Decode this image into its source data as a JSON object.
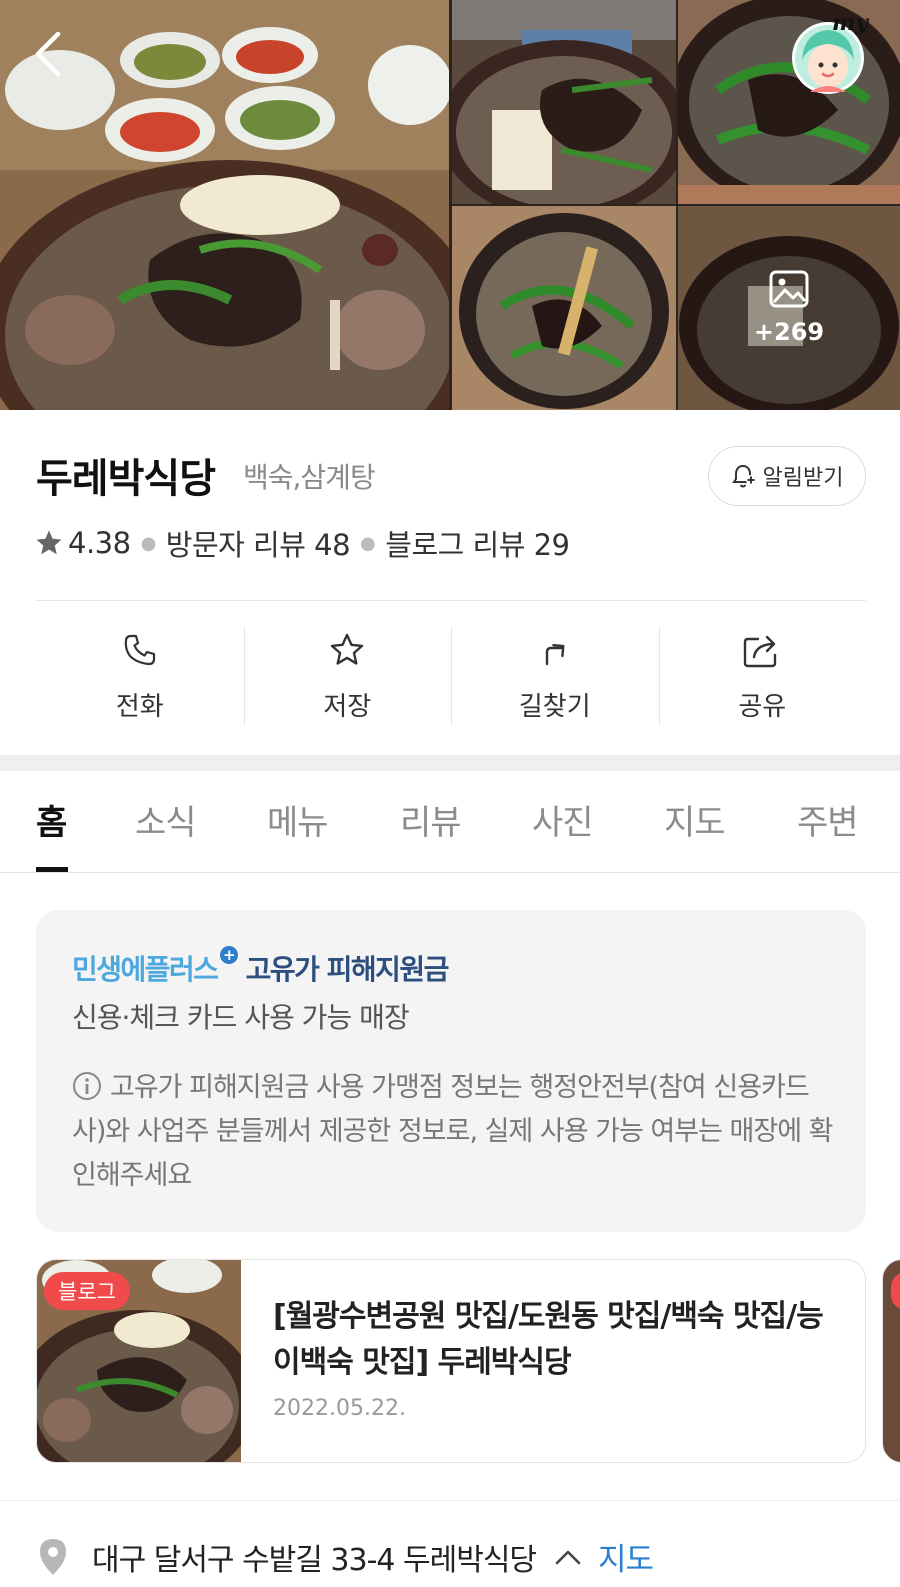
{
  "photos": {
    "more_count": "+269",
    "profile_badge": "my"
  },
  "place": {
    "name": "두레박식당",
    "category": "백숙,삼계탕",
    "alarm_label": "알림받기",
    "rating": "4.38",
    "visitor_reviews": "방문자 리뷰 48",
    "blog_reviews": "블로그 리뷰 29"
  },
  "actions": [
    {
      "label": "전화",
      "icon": "phone-icon"
    },
    {
      "label": "저장",
      "icon": "star-icon"
    },
    {
      "label": "길찾기",
      "icon": "directions-icon"
    },
    {
      "label": "공유",
      "icon": "share-icon"
    }
  ],
  "tabs": [
    {
      "label": "홈",
      "active": true
    },
    {
      "label": "소식"
    },
    {
      "label": "메뉴"
    },
    {
      "label": "리뷰"
    },
    {
      "label": "사진"
    },
    {
      "label": "지도"
    },
    {
      "label": "주변"
    }
  ],
  "notice": {
    "brand_main": "민생에플러스",
    "brand_sub": "고유가 피해지원금",
    "subtitle": "신용·체크 카드 사용 가능 매장",
    "info": "고유가 피해지원금 사용 가맹점 정보는 행정안전부(참여 신용카드사)와 사업주 분들께서 제공한 정보로, 실제 사용 가능 여부는 매장에 확인해주세요"
  },
  "blog": {
    "badge": "블로그",
    "title": "[월광수변공원 맛집/도원동 맛집/백숙 맛집/능이백숙 맛집] 두레박식당",
    "date": "2022.05.22."
  },
  "address": {
    "text": "대구 달서구 수밭길 33-4 두레박식당",
    "map_link": "지도"
  },
  "colors": {
    "accent_blue": "#2b7fd3",
    "badge_red": "#f04a4a",
    "brand_light": "#4ea8de",
    "brand_dark": "#2d4f7f"
  }
}
